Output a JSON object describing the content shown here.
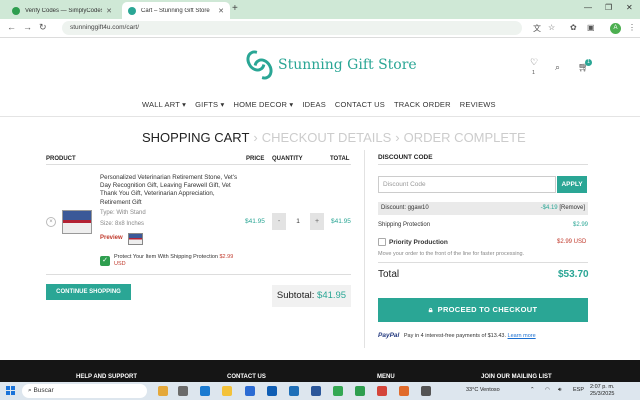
{
  "browser": {
    "tabs": [
      {
        "title": "Verify Codes — SimplyCodes",
        "active": false
      },
      {
        "title": "Cart – Stunning Gift Store",
        "active": true
      }
    ],
    "url": "stunninggift4u.com/cart/",
    "profile_initial": "A"
  },
  "header": {
    "logo_text": "Stunning Gift Store",
    "wishlist_count": "1",
    "cart_count": "1"
  },
  "nav": {
    "items": [
      "WALL ART",
      "GIFTS",
      "HOME DECOR",
      "IDEAS",
      "CONTACT US",
      "TRACK ORDER",
      "REVIEWS"
    ]
  },
  "steps": {
    "current": "SHOPPING CART",
    "next": "CHECKOUT DETAILS",
    "last": "ORDER COMPLETE",
    "separator": "›"
  },
  "cart": {
    "columns": {
      "product": "PRODUCT",
      "price": "PRICE",
      "quantity": "QUANTITY",
      "total": "TOTAL"
    },
    "item": {
      "name": "Personalized Veterinarian Retirement Stone, Vet's Day Recognition Gift, Leaving Farewell Gift, Vet Thank You Gift, Veterinarian Appreciation, Retirement Gift",
      "type": "Type: With Stand",
      "size": "Size: 8x8 Inches",
      "preview_label": "Preview",
      "price": "$41.95",
      "quantity": "1",
      "total": "$41.95",
      "minus": "-",
      "plus": "+"
    },
    "protect": {
      "text": "Protect Your Item With Shipping Protection",
      "amount": "$2.99 USD"
    },
    "continue_label": "CONTINUE SHOPPING",
    "subtotal_label": "Subtotal:",
    "subtotal_value": "$41.95"
  },
  "summary": {
    "discount_title": "DISCOUNT CODE",
    "discount_placeholder": "Discount Code",
    "apply_label": "APPLY",
    "discount_label": "Discount: ggaw10",
    "discount_amount": "-$4.19",
    "remove_label": "[Remove]",
    "shipping_label": "Shipping Protection",
    "shipping_value": "$2.99",
    "priority_label": "Priority Production",
    "priority_price": "$2.99 USD",
    "priority_desc": "Move your order to the front of the line for faster processing.",
    "total_label": "Total",
    "total_value": "$53.70",
    "checkout_label": "PROCEED TO CHECKOUT",
    "paypal_logo": "PayPal",
    "paypal_text": "Pay in 4 interest-free payments of $13.43.",
    "paypal_learn": "Learn more"
  },
  "footer": {
    "headings": [
      "HELP AND SUPPORT",
      "CONTACT US",
      "MENU",
      "JOIN OUR MAILING LIST"
    ]
  },
  "taskbar": {
    "search_label": "Buscar",
    "weather": "33°C  Ventoso",
    "lang": "ESP",
    "time": "2:07 p. m.",
    "date": "25/3/2025"
  },
  "colors": {
    "accent": "#2aa695",
    "danger": "#c0392b",
    "footer_bg": "#151515",
    "tabbar_bg": "#cfe8d6"
  },
  "icons": [
    "heart-icon",
    "search-icon",
    "cart-icon",
    "lock-icon",
    "check-icon",
    "close-icon"
  ]
}
